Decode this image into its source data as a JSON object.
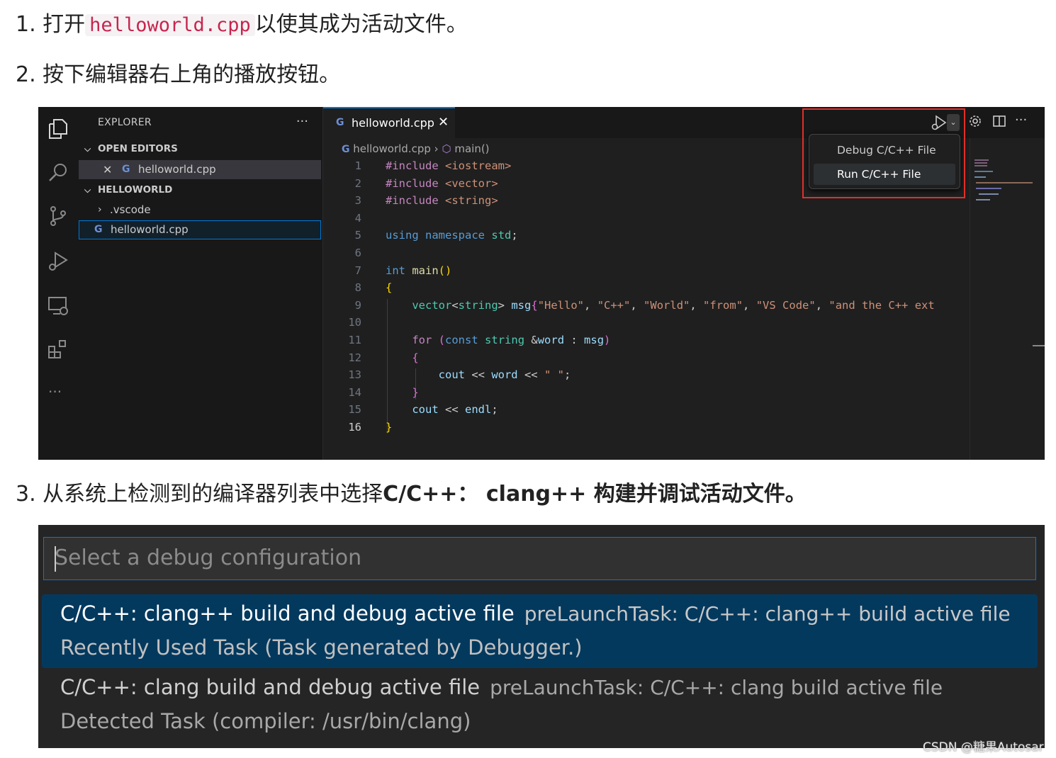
{
  "steps": {
    "s1_num": "1.",
    "s1_pre": "打开",
    "s1_code": "helloworld.cpp",
    "s1_post": "以使其成为活动文件。",
    "s2": "2. 按下编辑器右上角的播放按钮。",
    "s3_pre": "3. 从系统上检测到的编译器列表中选择",
    "s3_bold": "C/C++： clang++ 构建并调试活动文件。"
  },
  "explorer": {
    "title": "EXPLORER",
    "more": "···",
    "open_editors": "OPEN EDITORS",
    "open_file": "helloworld.cpp",
    "folder": "HELLOWORLD",
    "vscode_folder": ".vscode",
    "file": "helloworld.cpp"
  },
  "editor": {
    "tab_label": "helloworld.cpp",
    "crumb_file": "helloworld.cpp",
    "crumb_symbol": "main()",
    "line_numbers": [
      "1",
      "2",
      "3",
      "4",
      "5",
      "6",
      "7",
      "8",
      "9",
      "10",
      "11",
      "12",
      "13",
      "14",
      "15",
      "16"
    ]
  },
  "run_menu": {
    "debug": "Debug C/C++ File",
    "run": "Run C/C++ File"
  },
  "quick_pick": {
    "placeholder": "Select a debug configuration",
    "items": [
      {
        "label": "C/C++: clang++ build and debug active file",
        "desc": "preLaunchTask: C/C++: clang++ build active file",
        "detail": "Recently Used Task (Task generated by Debugger.)"
      },
      {
        "label": "C/C++: clang build and debug active file",
        "desc": "preLaunchTask: C/C++: clang build active file",
        "detail": "Detected Task (compiler: /usr/bin/clang)"
      }
    ]
  },
  "watermark": "CSDN @糖果Autosar",
  "colors": {
    "accent": "#0078d4",
    "highlight_box": "#e0302a",
    "selection": "#04395e"
  }
}
